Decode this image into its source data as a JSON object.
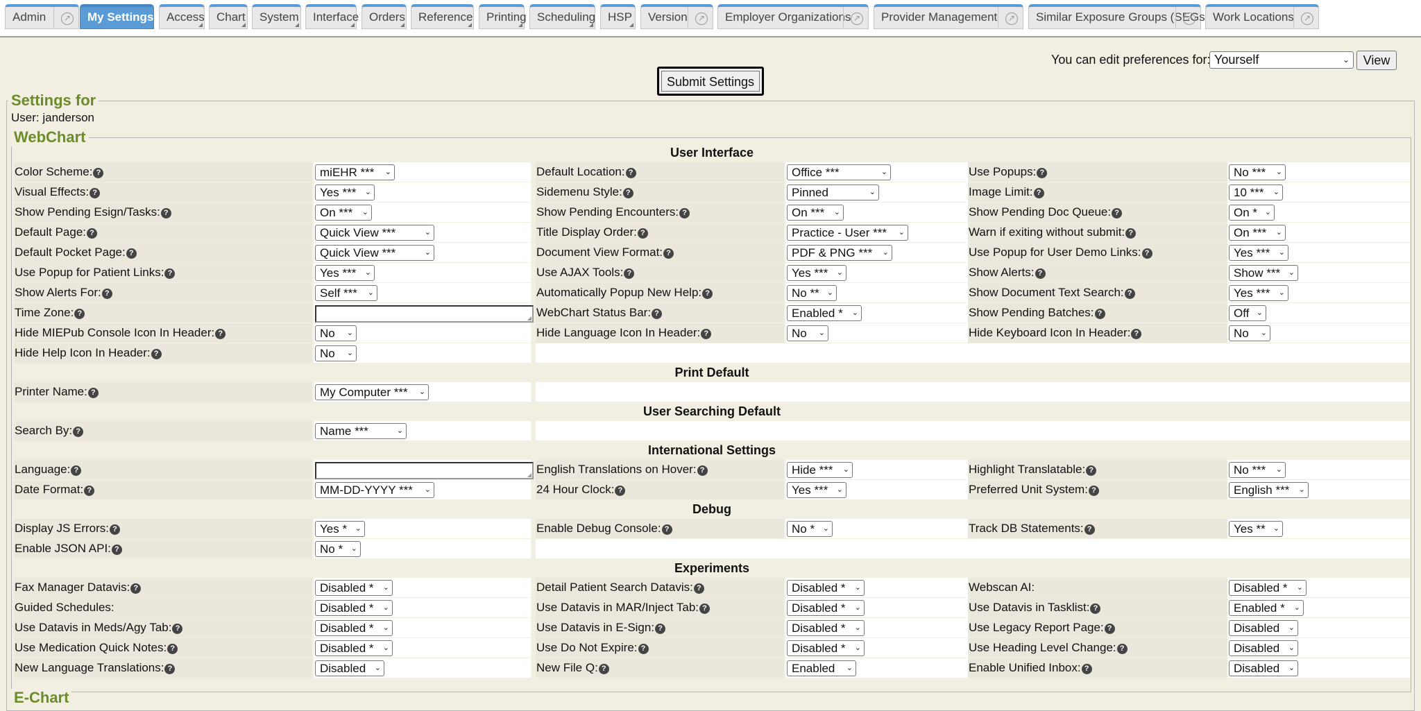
{
  "tabs": [
    {
      "label": "Admin",
      "ext": true
    },
    {
      "label": "My Settings",
      "active": true
    },
    {
      "label": "Access",
      "tri": true
    },
    {
      "label": "Chart",
      "tri": true
    },
    {
      "label": "System",
      "tri": true
    },
    {
      "label": "Interface",
      "tri": true
    },
    {
      "label": "Orders",
      "tri": true
    },
    {
      "label": "Reference",
      "tri": true
    },
    {
      "label": "Printing",
      "tri": true
    },
    {
      "label": "Scheduling",
      "tri": true
    },
    {
      "label": "HSP",
      "tri": true
    },
    {
      "label": "Version",
      "ext": true
    },
    {
      "label": "Employer Organizations",
      "ext": true
    },
    {
      "label": "Provider Management",
      "ext": true
    },
    {
      "label": "Similar Exposure Groups (SEGs)",
      "ext": true
    },
    {
      "label": "Work Locations",
      "ext": true
    }
  ],
  "prefs": {
    "label": "You can edit preferences for:",
    "selected": "Yourself",
    "view_label": "View"
  },
  "submit_label": "Submit Settings",
  "settings_for": {
    "legend": "Settings for",
    "user_line": "User: janderson"
  },
  "webchart_legend": "WebChart",
  "echart_legend": "E-Chart",
  "help_glyph": "?",
  "sections": [
    {
      "title": "User Interface",
      "rows": [
        [
          [
            "Color Scheme:",
            true,
            "miEHR ***"
          ],
          [
            "Default Location:",
            true,
            "Office ***"
          ],
          [
            "Use Popups:",
            true,
            "No ***"
          ]
        ],
        [
          [
            "Visual Effects:",
            true,
            "Yes ***"
          ],
          [
            "Sidemenu Style:",
            true,
            "Pinned"
          ],
          [
            "Image Limit:",
            true,
            "10 ***"
          ]
        ],
        [
          [
            "Show Pending Esign/Tasks:",
            true,
            "On ***"
          ],
          [
            "Show Pending Encounters:",
            true,
            "On ***"
          ],
          [
            "Show Pending Doc Queue:",
            true,
            "On *"
          ]
        ],
        [
          [
            "Default Page:",
            true,
            "Quick View ***"
          ],
          [
            "Title Display Order:",
            true,
            "Practice - User ***"
          ],
          [
            "Warn if exiting without submit:",
            true,
            "On ***"
          ]
        ],
        [
          [
            "Default Pocket Page:",
            true,
            "Quick View ***"
          ],
          [
            "Document View Format:",
            true,
            "PDF & PNG ***"
          ],
          [
            "Use Popup for User Demo Links:",
            true,
            "Yes ***"
          ]
        ],
        [
          [
            "Use Popup for Patient Links:",
            true,
            "Yes ***"
          ],
          [
            "Use AJAX Tools:",
            true,
            "Yes ***"
          ],
          [
            "Show Alerts:",
            true,
            "Show ***"
          ]
        ],
        [
          [
            "Show Alerts For:",
            true,
            "Self ***"
          ],
          [
            "Automatically Popup New Help:",
            true,
            "No **"
          ],
          [
            "Show Document Text Search:",
            true,
            "Yes ***"
          ]
        ],
        [
          [
            "Time Zone:",
            true,
            ""
          ],
          [
            "WebChart Status Bar:",
            true,
            "Enabled *"
          ],
          [
            "Show Pending Batches:",
            true,
            "Off"
          ]
        ],
        [
          [
            "Hide MIEPub Console Icon In Header:",
            true,
            "No"
          ],
          [
            "Hide Language Icon In Header:",
            true,
            "No"
          ],
          [
            "Hide Keyboard Icon In Header:",
            true,
            "No"
          ]
        ],
        [
          [
            "Hide Help Icon In Header:",
            true,
            "No"
          ]
        ]
      ]
    },
    {
      "title": "Print Default",
      "rows": [
        [
          [
            "Printer Name:",
            true,
            "My Computer ***"
          ]
        ]
      ]
    },
    {
      "title": "User Searching Default",
      "rows": [
        [
          [
            "Search By:",
            true,
            "Name ***"
          ]
        ]
      ]
    },
    {
      "title": "International Settings",
      "rows": [
        [
          [
            "Language:",
            true,
            ""
          ],
          [
            "English Translations on Hover:",
            true,
            "Hide ***"
          ],
          [
            "Highlight Translatable:",
            true,
            "No ***"
          ]
        ],
        [
          [
            "Date Format:",
            true,
            "MM-DD-YYYY ***"
          ],
          [
            "24 Hour Clock:",
            true,
            "Yes ***"
          ],
          [
            "Preferred Unit System:",
            true,
            "English ***"
          ]
        ]
      ]
    },
    {
      "title": "Debug",
      "rows": [
        [
          [
            "Display JS Errors:",
            true,
            "Yes *"
          ],
          [
            "Enable Debug Console:",
            true,
            "No *"
          ],
          [
            "Track DB Statements:",
            true,
            "Yes **"
          ]
        ],
        [
          [
            "Enable JSON API:",
            true,
            "No *"
          ]
        ]
      ]
    },
    {
      "title": "Experiments",
      "rows": [
        [
          [
            "Fax Manager Datavis:",
            true,
            "Disabled *"
          ],
          [
            "Detail Patient Search Datavis:",
            true,
            "Disabled *"
          ],
          [
            "Webscan AI:",
            false,
            "Disabled *"
          ]
        ],
        [
          [
            "Guided Schedules:",
            false,
            "Disabled *"
          ],
          [
            "Use Datavis in MAR/Inject Tab:",
            true,
            "Disabled *"
          ],
          [
            "Use Datavis in Tasklist:",
            true,
            "Enabled *"
          ]
        ],
        [
          [
            "Use Datavis in Meds/Agy Tab:",
            true,
            "Disabled *"
          ],
          [
            "Use Datavis in E-Sign:",
            true,
            "Disabled *"
          ],
          [
            "Use Legacy Report Page:",
            true,
            "Disabled"
          ]
        ],
        [
          [
            "Use Medication Quick Notes:",
            true,
            "Disabled *"
          ],
          [
            "Use Do Not Expire:",
            true,
            "Disabled *"
          ],
          [
            "Use Heading Level Change:",
            true,
            "Disabled"
          ]
        ],
        [
          [
            "New Language Translations:",
            true,
            "Disabled"
          ],
          [
            "New File Q:",
            true,
            "Enabled"
          ],
          [
            "Enable Unified Inbox:",
            true,
            "Disabled"
          ]
        ]
      ]
    }
  ]
}
